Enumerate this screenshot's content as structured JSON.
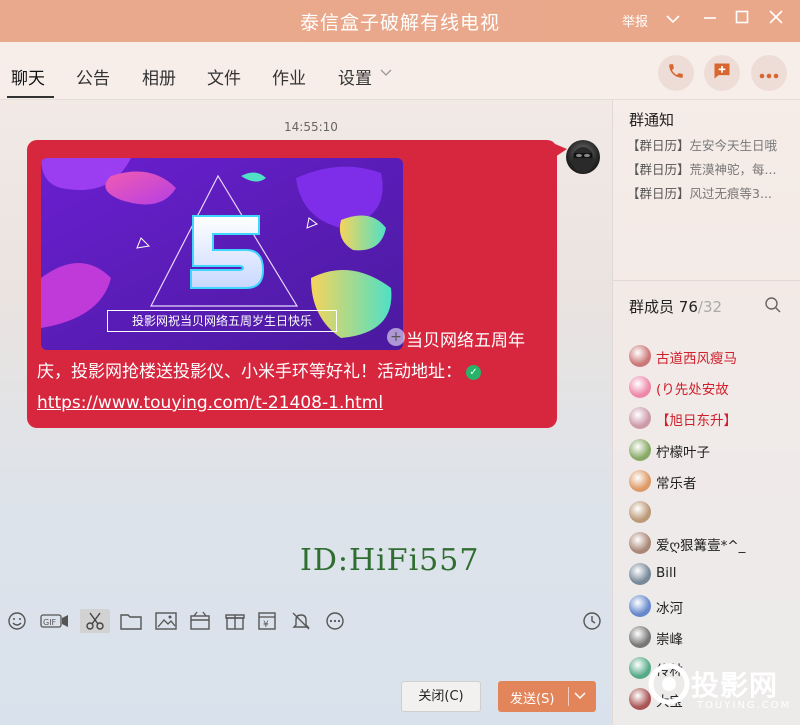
{
  "window": {
    "title": "泰信盒子破解有线电视",
    "report": "举报"
  },
  "tabs": [
    {
      "label": "聊天"
    },
    {
      "label": "公告"
    },
    {
      "label": "相册"
    },
    {
      "label": "文件"
    },
    {
      "label": "作业"
    },
    {
      "label": "设置"
    }
  ],
  "chat": {
    "timestamp": "14:55:10",
    "promo_caption": "投影网祝当贝网络五周岁生日快乐",
    "message_line1": "当贝网络五周年",
    "message_line2": "庆，投影网抢楼送投影仪、小米手环等好礼！活动地址：",
    "message_link": "https://www.touying.com/t-21408-1.html",
    "watermark": "ID:HiFi557"
  },
  "buttons": {
    "close": "关闭(C)",
    "send": "发送(S)"
  },
  "group_notice": {
    "title": "群通知",
    "items": [
      {
        "tag": "【群日历】",
        "text": "左安今天生日哦"
      },
      {
        "tag": "【群日历】",
        "text": "荒漠神驼，每..."
      },
      {
        "tag": "【群日历】",
        "text": "风过无痕等3..."
      }
    ]
  },
  "members": {
    "title": "群成员",
    "count": "76",
    "total": "/32",
    "list": [
      {
        "name": "古道西风瘦马",
        "style": "red"
      },
      {
        "name": "(り先处安故",
        "style": "red"
      },
      {
        "name": "【旭日东升】",
        "style": "red"
      },
      {
        "name": "柠檬叶子",
        "style": "dark"
      },
      {
        "name": "常乐者",
        "style": "dark"
      },
      {
        "name": "",
        "style": "dark"
      },
      {
        "name": "爱ღ狠篝壹*^_",
        "style": "dark"
      },
      {
        "name": "Bill",
        "style": "dark"
      },
      {
        "name": "冰河",
        "style": "dark"
      },
      {
        "name": "崇峰",
        "style": "dark"
      },
      {
        "name": "传林",
        "style": "dark"
      },
      {
        "name": "大宝",
        "style": "dark"
      }
    ]
  },
  "logo": {
    "name": "投影网",
    "sub": "TOUYING.COM"
  },
  "colors": {
    "titlebar": "#e8a98c",
    "bubble": "#d7273f",
    "send_button": "#e3855a",
    "member_highlight": "#d0202c"
  }
}
